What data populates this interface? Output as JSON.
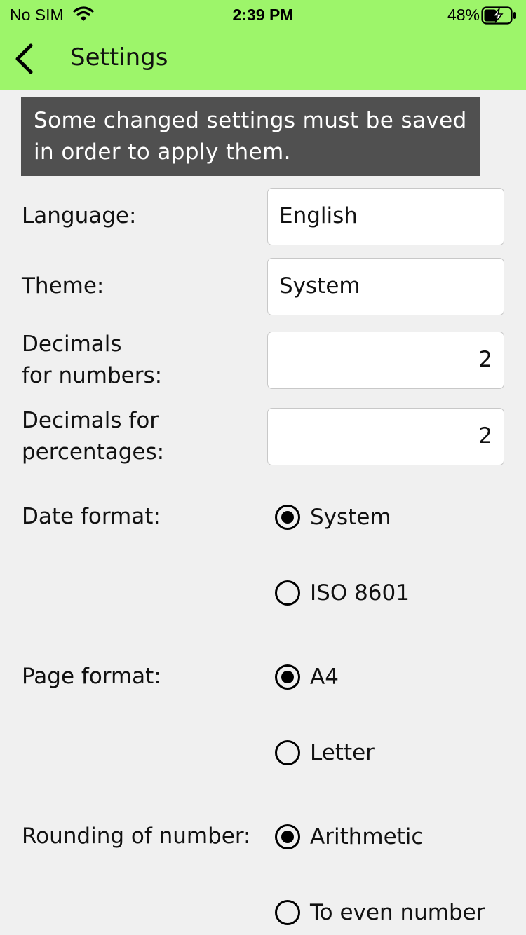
{
  "status_bar": {
    "carrier": "No SIM",
    "time": "2:39 PM",
    "battery": "48%"
  },
  "nav": {
    "title": "Settings"
  },
  "notice": "Some changed settings must be saved in order to apply them.",
  "fields": {
    "language": {
      "label": "Language:",
      "value": "English"
    },
    "theme": {
      "label": "Theme:",
      "value": "System"
    },
    "decimals_numbers": {
      "label_line1": "Decimals",
      "label_line2": "for numbers:",
      "value": "2"
    },
    "decimals_percentages": {
      "label_line1": "Decimals for",
      "label_line2": "percentages:",
      "value": "2"
    }
  },
  "date_format": {
    "label": "Date format:",
    "options": [
      {
        "label": "System",
        "selected": true
      },
      {
        "label": "ISO 8601",
        "selected": false
      }
    ]
  },
  "page_format": {
    "label": "Page format:",
    "options": [
      {
        "label": "A4",
        "selected": true
      },
      {
        "label": "Letter",
        "selected": false
      }
    ]
  },
  "rounding": {
    "label": "Rounding of number:",
    "options": [
      {
        "label": "Arithmetic",
        "selected": true
      },
      {
        "label": "To even number",
        "selected": false
      }
    ]
  },
  "colors": {
    "header_bg": "#9df56a",
    "notice_bg": "#505050",
    "page_bg": "#f0f0f0"
  }
}
